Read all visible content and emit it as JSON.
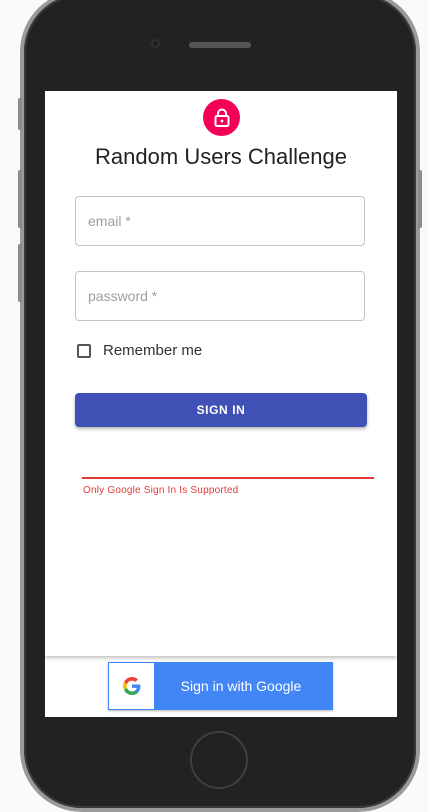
{
  "app": {
    "title": "Random Users Challenge",
    "lock_icon": "lock-icon",
    "accent_color": "#f50057",
    "primary_color": "#3f51b5"
  },
  "form": {
    "email": {
      "placeholder": "email *",
      "value": ""
    },
    "password": {
      "placeholder": "password *",
      "value": ""
    },
    "remember_label": "Remember me",
    "remember_checked": false,
    "signin_label": "SIGN IN"
  },
  "error": {
    "message": "Only Google Sign In Is Supported",
    "color": "#e53935"
  },
  "google": {
    "label": "Sign in with Google",
    "icon": "google-icon",
    "color": "#4285f4"
  }
}
